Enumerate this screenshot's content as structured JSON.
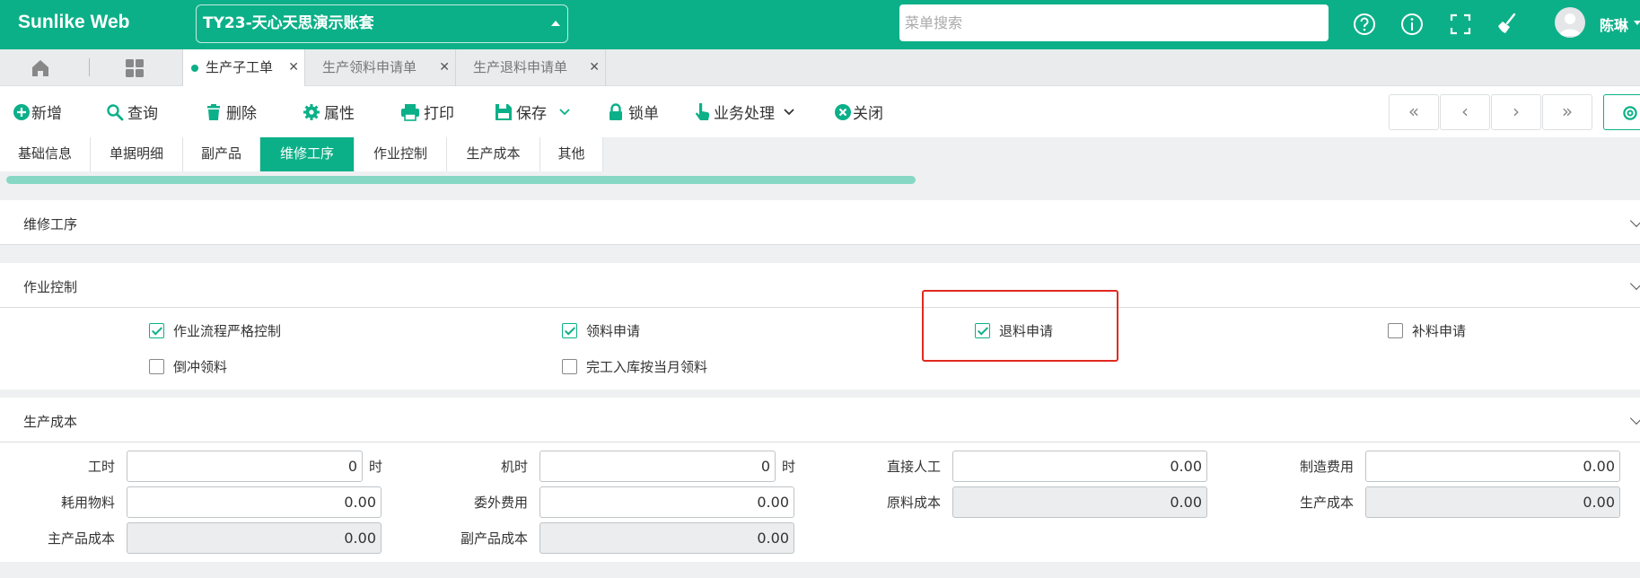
{
  "header": {
    "brand": "Sunlike Web",
    "account": "TY23-天心天思演示账套",
    "search_placeholder": "菜单搜索",
    "user_name": "陈琳"
  },
  "page_tabs": [
    {
      "label": "生产子工单",
      "active": true
    },
    {
      "label": "生产领料申请单",
      "active": false
    },
    {
      "label": "生产退料申请单",
      "active": false
    }
  ],
  "toolbar": {
    "new": "新增",
    "query": "查询",
    "delete": "删除",
    "properties": "属性",
    "print": "打印",
    "save": "保存",
    "lock": "锁单",
    "business": "业务处理",
    "close": "关闭"
  },
  "nav": {
    "first": "«",
    "prev": "‹",
    "next": "›",
    "last": "»"
  },
  "section_tabs": [
    "基础信息",
    "单据明细",
    "副产品",
    "维修工序",
    "作业控制",
    "生产成本",
    "其他"
  ],
  "active_section_tab": "维修工序",
  "panels": {
    "repair": {
      "title": "维修工序"
    },
    "control": {
      "title": "作业控制",
      "options": [
        {
          "label": "作业流程严格控制",
          "checked": true
        },
        {
          "label": "领料申请",
          "checked": true
        },
        {
          "label": "退料申请",
          "checked": true
        },
        {
          "label": "补料申请",
          "checked": false
        },
        {
          "label": "倒冲领料",
          "checked": false
        },
        {
          "label": "完工入库按当月领料",
          "checked": false
        }
      ]
    },
    "cost": {
      "title": "生产成本",
      "fields": {
        "work_hours": {
          "label": "工时",
          "value": "0",
          "unit": "时"
        },
        "machine_hours": {
          "label": "机时",
          "value": "0",
          "unit": "时"
        },
        "direct_labor": {
          "label": "直接人工",
          "value": "0.00"
        },
        "manufacturing_cost": {
          "label": "制造费用",
          "value": "0.00"
        },
        "consumables": {
          "label": "耗用物料",
          "value": "0.00"
        },
        "outsourcing": {
          "label": "委外费用",
          "value": "0.00"
        },
        "raw_material_cost": {
          "label": "原料成本",
          "value": "0.00"
        },
        "production_cost": {
          "label": "生产成本",
          "value": "0.00"
        },
        "main_product_cost": {
          "label": "主产品成本",
          "value": "0.00"
        },
        "by_product_cost": {
          "label": "副产品成本",
          "value": "0.00"
        }
      }
    }
  },
  "colors": {
    "brand": "#0cb088",
    "highlight": "#e02a1f"
  }
}
